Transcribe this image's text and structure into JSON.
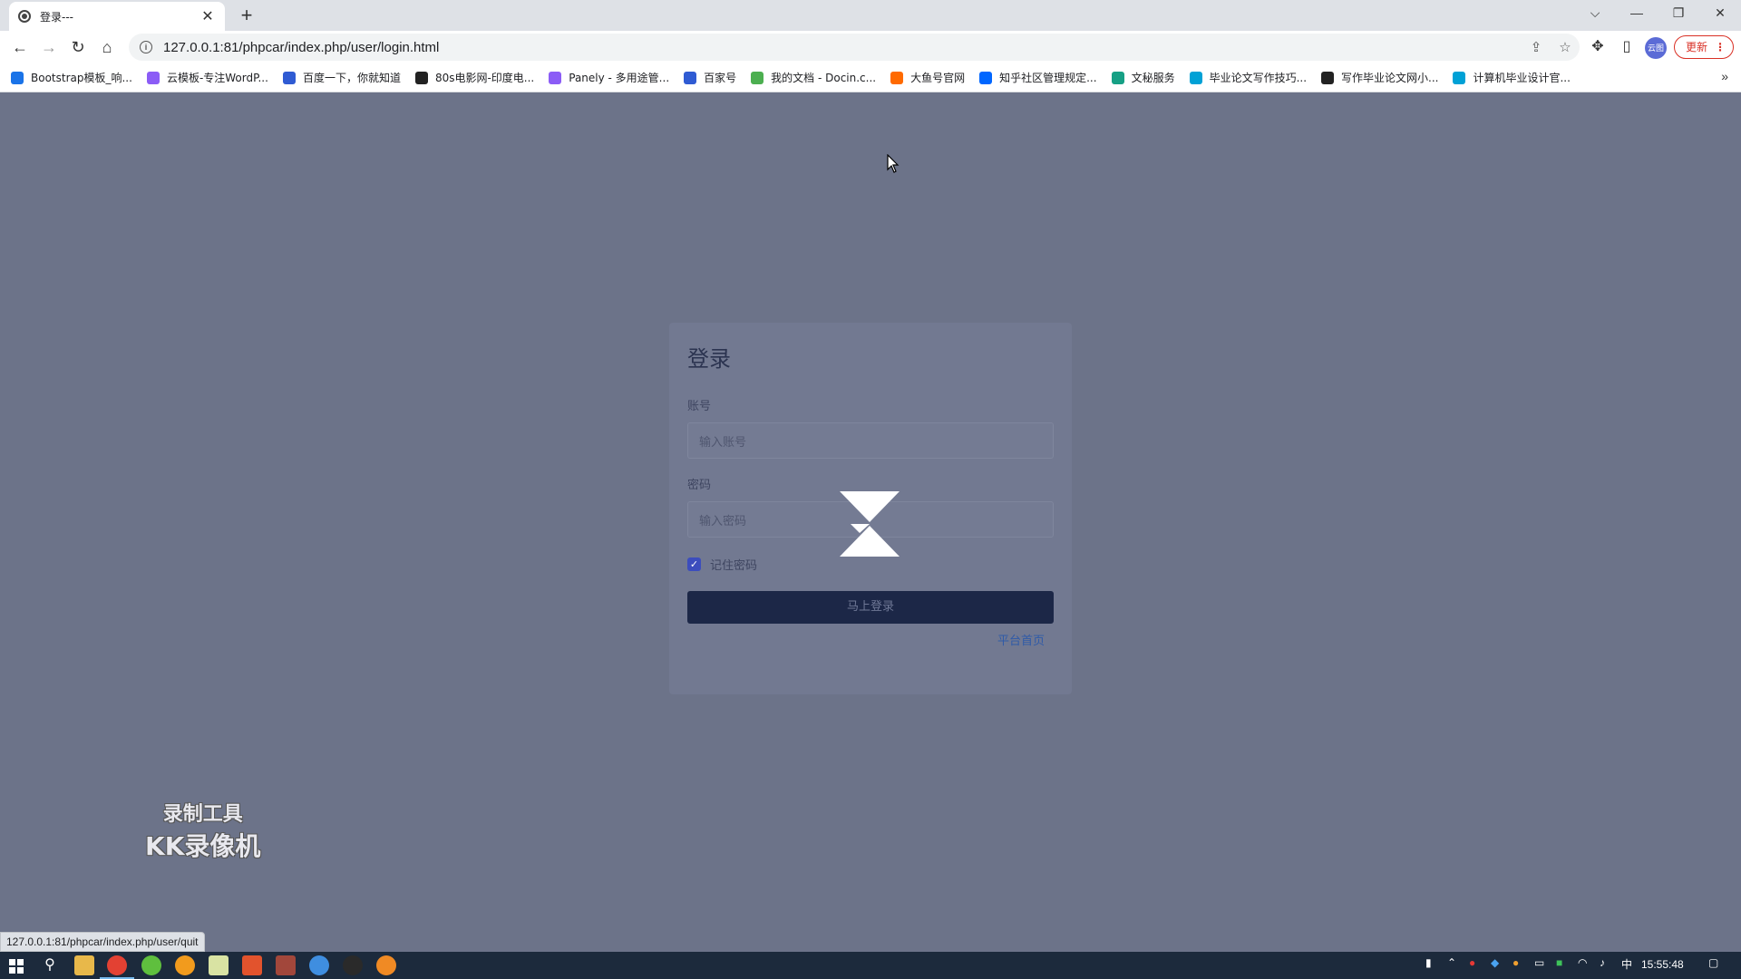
{
  "browser": {
    "tab_title": "登录---",
    "url": "127.0.0.1:81/phpcar/index.php/user/login.html",
    "update_label": "更新",
    "avatar_label": "云图"
  },
  "bookmarks": [
    {
      "label": "Bootstrap模板_响...",
      "color": "#1a73e8"
    },
    {
      "label": "云模板-专注WordP...",
      "color": "#8b5cf6"
    },
    {
      "label": "百度一下，你就知道",
      "color": "#2f5bd3"
    },
    {
      "label": "80s电影网-印度电...",
      "color": "#222222"
    },
    {
      "label": "Panely - 多用途管...",
      "color": "#8b5cf6"
    },
    {
      "label": "百家号",
      "color": "#2f5bd3"
    },
    {
      "label": "我的文档 - Docin.c...",
      "color": "#4caf50"
    },
    {
      "label": "大鱼号官网",
      "color": "#ff6a00"
    },
    {
      "label": "知乎社区管理规定...",
      "color": "#0066ff"
    },
    {
      "label": "文秘服务",
      "color": "#16a085"
    },
    {
      "label": "毕业论文写作技巧...",
      "color": "#00a1d6"
    },
    {
      "label": "写作毕业论文网小...",
      "color": "#222222"
    },
    {
      "label": "计算机毕业设计官...",
      "color": "#00a1d6"
    }
  ],
  "login": {
    "title": "登录",
    "account_label": "账号",
    "account_placeholder": "输入账号",
    "password_label": "密码",
    "password_placeholder": "输入密码",
    "remember_label": "记住密码",
    "remember_checked": true,
    "submit_label": "马上登录",
    "home_link": "平台首页"
  },
  "watermark": {
    "line1": "录制工具",
    "line2": "KK录像机"
  },
  "status_url": "127.0.0.1:81/phpcar/index.php/user/quit",
  "taskbar": {
    "clock": "15:55:48",
    "ime": "中"
  },
  "colors": {
    "overlay": "#6c7389",
    "primary_button": "#1c2747",
    "link": "#2f5aa8",
    "checkbox": "#3c4dbd"
  }
}
